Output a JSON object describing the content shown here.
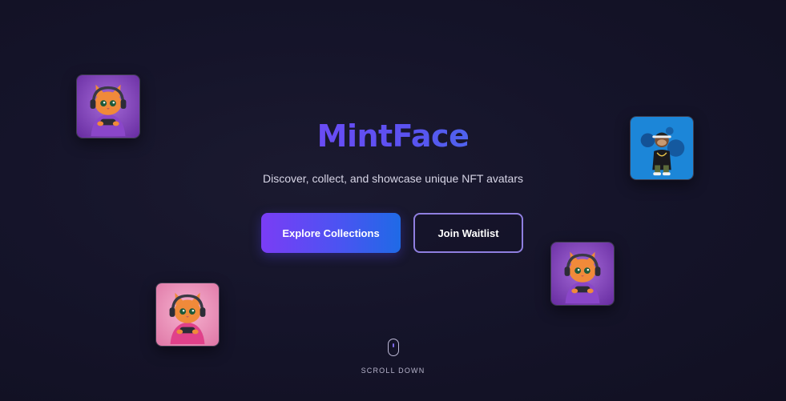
{
  "hero": {
    "title": "MintFace",
    "subtitle": "Discover, collect, and showcase unique NFT avatars"
  },
  "actions": {
    "primary_label": "Explore Collections",
    "secondary_label": "Join Waitlist"
  },
  "scroll": {
    "label": "SCROLL DOWN"
  },
  "avatars": [
    {
      "name": "cat-gamer-purple",
      "background": "#7b3fb8"
    },
    {
      "name": "monkey-streetwear-blue",
      "background": "#1c86d8"
    },
    {
      "name": "cat-gamer-purple-2",
      "background": "#7b3fb8"
    },
    {
      "name": "cat-gamer-pink",
      "background": "#e98fb7"
    }
  ],
  "colors": {
    "background": "#15142a",
    "title_gradient_start": "#6a4cf5",
    "title_gradient_end": "#4f63ee",
    "primary_button_start": "#7a3df5",
    "primary_button_end": "#1f6ae6",
    "secondary_button_border": "#8f7fe0",
    "scroll_wheel": "#7f6bea"
  }
}
